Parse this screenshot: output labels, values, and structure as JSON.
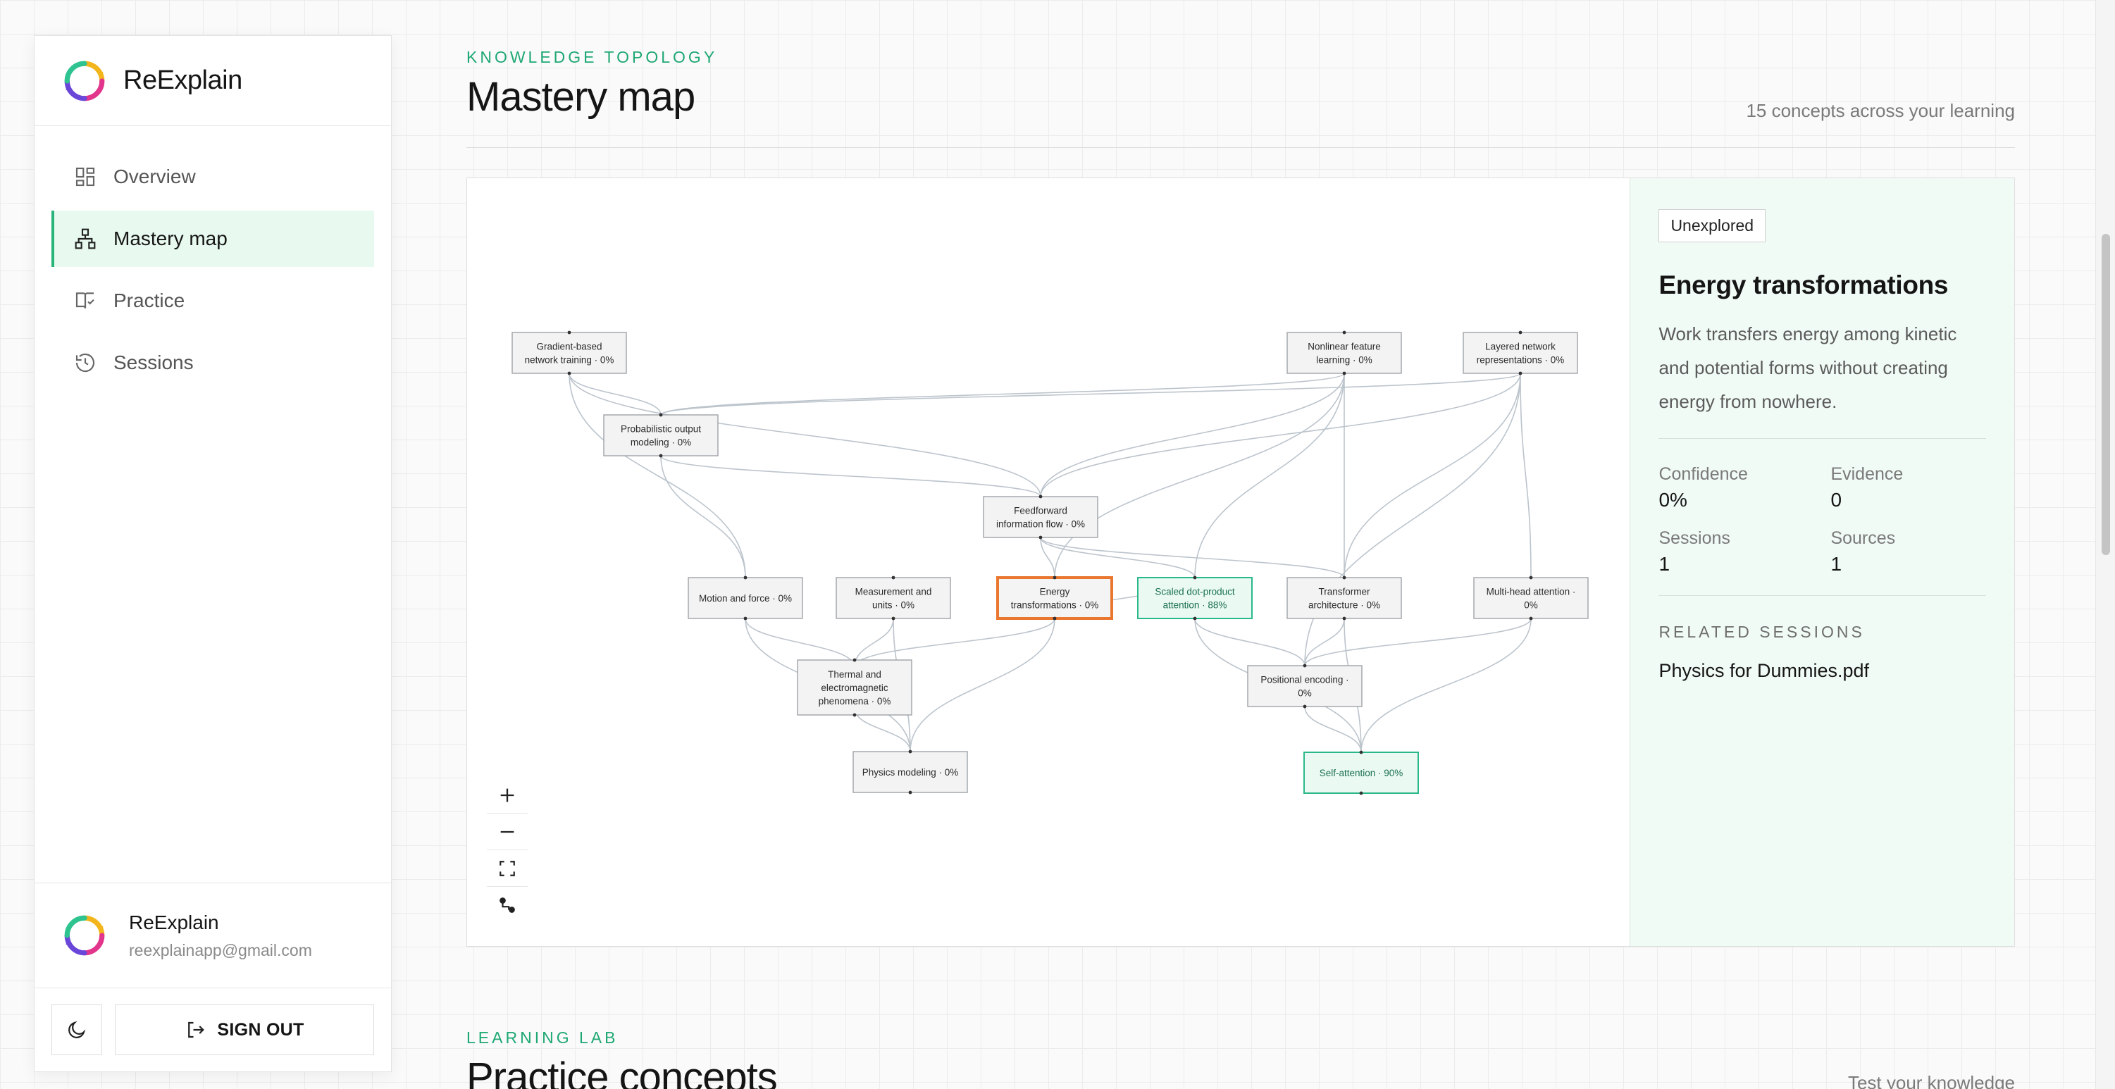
{
  "app": {
    "name": "ReExplain"
  },
  "sidebar": {
    "items": [
      {
        "label": "Overview",
        "icon": "grid-icon"
      },
      {
        "label": "Mastery map",
        "icon": "sitemap-icon",
        "active": true
      },
      {
        "label": "Practice",
        "icon": "book-check-icon"
      },
      {
        "label": "Sessions",
        "icon": "history-icon"
      }
    ],
    "user": {
      "name": "ReExplain",
      "email": "reexplainapp@gmail.com"
    },
    "theme_icon": "moon-icon",
    "signout_label": "SIGN OUT"
  },
  "header": {
    "kicker": "KNOWLEDGE TOPOLOGY",
    "title": "Mastery map",
    "summary": "15 concepts across your learning"
  },
  "map": {
    "nodes": [
      {
        "id": "gbnt",
        "lines": [
          "Gradient-based",
          "network training · 0%"
        ],
        "state": "unexplored"
      },
      {
        "id": "nfl",
        "lines": [
          "Nonlinear feature",
          "learning · 0%"
        ],
        "state": "unexplored"
      },
      {
        "id": "lnr",
        "lines": [
          "Layered network",
          "representations · 0%"
        ],
        "state": "unexplored"
      },
      {
        "id": "pom",
        "lines": [
          "Probabilistic output",
          "modeling · 0%"
        ],
        "state": "unexplored"
      },
      {
        "id": "fif",
        "lines": [
          "Feedforward",
          "information flow · 0%"
        ],
        "state": "unexplored"
      },
      {
        "id": "mf",
        "lines": [
          "Motion and force · 0%"
        ],
        "state": "unexplored"
      },
      {
        "id": "mu",
        "lines": [
          "Measurement and",
          "units · 0%"
        ],
        "state": "unexplored"
      },
      {
        "id": "et",
        "lines": [
          "Energy",
          "transformations · 0%"
        ],
        "state": "selected"
      },
      {
        "id": "sdpa",
        "lines": [
          "Scaled dot-product",
          "attention · 88%"
        ],
        "state": "mastered"
      },
      {
        "id": "ta",
        "lines": [
          "Transformer",
          "architecture · 0%"
        ],
        "state": "unexplored"
      },
      {
        "id": "mha",
        "lines": [
          "Multi-head attention ·",
          "0%"
        ],
        "state": "unexplored"
      },
      {
        "id": "tep",
        "lines": [
          "Thermal and",
          "electromagnetic",
          "phenomena · 0%"
        ],
        "state": "unexplored"
      },
      {
        "id": "pe",
        "lines": [
          "Positional encoding ·",
          "0%"
        ],
        "state": "unexplored"
      },
      {
        "id": "pm",
        "lines": [
          "Physics modeling · 0%"
        ],
        "state": "unexplored"
      },
      {
        "id": "sa",
        "lines": [
          "Self-attention · 90%"
        ],
        "state": "mastered"
      }
    ],
    "edges": [
      [
        "gbnt",
        "pom"
      ],
      [
        "gbnt",
        "fif"
      ],
      [
        "gbnt",
        "mf"
      ],
      [
        "nfl",
        "pom"
      ],
      [
        "nfl",
        "fif"
      ],
      [
        "nfl",
        "ta"
      ],
      [
        "nfl",
        "sdpa"
      ],
      [
        "nfl",
        "et"
      ],
      [
        "lnr",
        "pom"
      ],
      [
        "lnr",
        "fif"
      ],
      [
        "lnr",
        "ta"
      ],
      [
        "lnr",
        "mha"
      ],
      [
        "lnr",
        "pe"
      ],
      [
        "pom",
        "fif"
      ],
      [
        "pom",
        "mf"
      ],
      [
        "fif",
        "sdpa"
      ],
      [
        "fif",
        "ta"
      ],
      [
        "fif",
        "et"
      ],
      [
        "mf",
        "tep"
      ],
      [
        "mf",
        "pm"
      ],
      [
        "mu",
        "tep"
      ],
      [
        "mu",
        "pm"
      ],
      [
        "et",
        "tep"
      ],
      [
        "et",
        "pm"
      ],
      [
        "et",
        "sdpa"
      ],
      [
        "tep",
        "pm"
      ],
      [
        "sdpa",
        "pe"
      ],
      [
        "sdpa",
        "sa"
      ],
      [
        "ta",
        "pe"
      ],
      [
        "ta",
        "sa"
      ],
      [
        "mha",
        "pe"
      ],
      [
        "mha",
        "sa"
      ],
      [
        "pe",
        "sa"
      ]
    ],
    "zoom_controls": [
      "zoom-in-icon",
      "zoom-out-icon",
      "fit-view-icon",
      "route-icon"
    ]
  },
  "detail": {
    "badge": "Unexplored",
    "title": "Energy transformations",
    "description": "Work transfers energy among kinetic and potential forms without creating energy from nowhere.",
    "stats": [
      {
        "label": "Confidence",
        "value": "0%"
      },
      {
        "label": "Evidence",
        "value": "0"
      },
      {
        "label": "Sessions",
        "value": "1"
      },
      {
        "label": "Sources",
        "value": "1"
      }
    ],
    "related_heading": "RELATED SESSIONS",
    "related": [
      "Physics for Dummies.pdf"
    ]
  },
  "lab": {
    "kicker": "LEARNING LAB",
    "title": "Practice concepts",
    "summary": "Test your knowledge"
  },
  "colors": {
    "accent": "#1fa874",
    "selected": "#e9772f",
    "mastered_border": "#2ab88a",
    "mastered_fill": "#eafaf3",
    "node_fill": "#f3f3f3",
    "edge": "#bcc4cc"
  }
}
